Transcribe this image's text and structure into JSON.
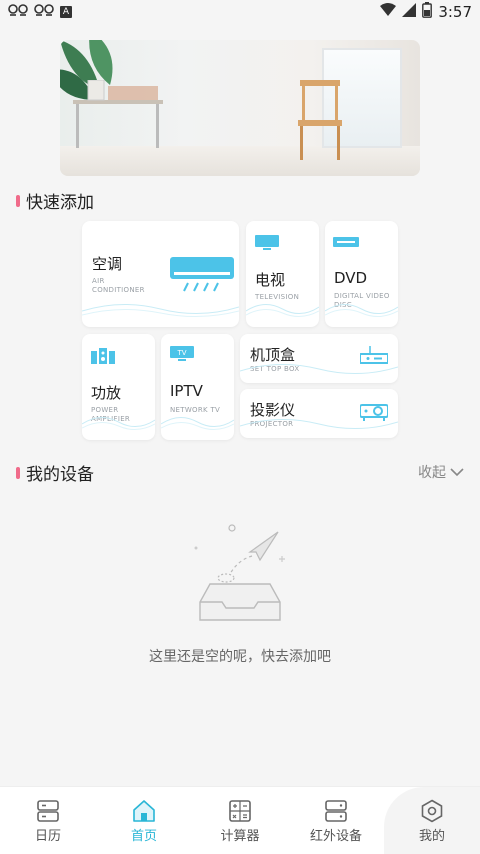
{
  "status": {
    "time": "3:57"
  },
  "quick_add": {
    "title": "快速添加",
    "cards": [
      {
        "cn": "空调",
        "en": "AIR\nCONDITIONER",
        "icon": "air-conditioner-icon"
      },
      {
        "cn": "电视",
        "en": "TELEVISION",
        "icon": "television-icon"
      },
      {
        "cn": "DVD",
        "en": "DIGITAL VIDEO\nDISC",
        "icon": "dvd-icon"
      },
      {
        "cn": "功放",
        "en": "POWER\nAMPLIFIER",
        "icon": "amplifier-icon"
      },
      {
        "cn": "IPTV",
        "en": "NETWORK TV",
        "icon": "iptv-icon"
      },
      {
        "cn": "机顶盒",
        "en": "SET TOP BOX",
        "icon": "set-top-box-icon"
      },
      {
        "cn": "投影仪",
        "en": "PROJECTOR",
        "icon": "projector-icon"
      }
    ]
  },
  "my_devices": {
    "title": "我的设备",
    "collapse_label": "收起",
    "empty_text": "这里还是空的呢，快去添加吧"
  },
  "nav": [
    {
      "label": "日历",
      "icon": "calendar-icon"
    },
    {
      "label": "首页",
      "icon": "home-icon",
      "active": true
    },
    {
      "label": "计算器",
      "icon": "calculator-icon"
    },
    {
      "label": "红外设备",
      "icon": "infrared-device-icon"
    },
    {
      "label": "我的",
      "icon": "profile-hexagon-icon"
    }
  ],
  "colors": {
    "accent": "#29b6d6",
    "section_bar": "#f06b8a",
    "icon_blue": "#4cc3e8"
  }
}
